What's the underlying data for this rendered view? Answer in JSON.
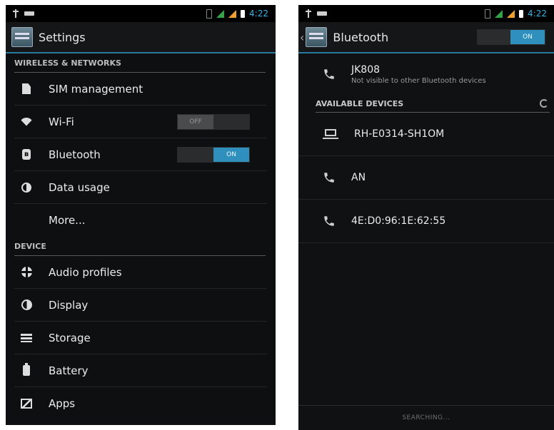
{
  "left_screen": {
    "statusbar": {
      "time": "4:22"
    },
    "actionbar": {
      "title": "Settings"
    },
    "sections": {
      "wireless": "WIRELESS & NETWORKS",
      "device": "DEVICE"
    },
    "items": {
      "sim": "SIM management",
      "wifi": "Wi-Fi",
      "wifi_toggle": "OFF",
      "bluetooth": "Bluetooth",
      "bluetooth_toggle": "ON",
      "data": "Data usage",
      "more": "More...",
      "audio": "Audio profiles",
      "display": "Display",
      "storage": "Storage",
      "battery": "Battery",
      "apps": "Apps"
    }
  },
  "right_screen": {
    "statusbar": {
      "time": "4:22"
    },
    "actionbar": {
      "title": "Bluetooth",
      "toggle": "ON"
    },
    "self_device": {
      "name": "JK808",
      "subtitle": "Not visible to other Bluetooth devices"
    },
    "section": "AVAILABLE DEVICES",
    "devices": [
      {
        "name": "RH-E0314-SH1OM",
        "icon": "laptop-icon"
      },
      {
        "name": "AN",
        "icon": "phone-icon"
      },
      {
        "name": "4E:D0:96:1E:62:55",
        "icon": "phone-icon"
      }
    ],
    "bottom_status": "SEARCHING..."
  },
  "colors": {
    "accent": "#2f8fbd",
    "background": "#0e0f10",
    "status_time": "#33b5e5"
  }
}
